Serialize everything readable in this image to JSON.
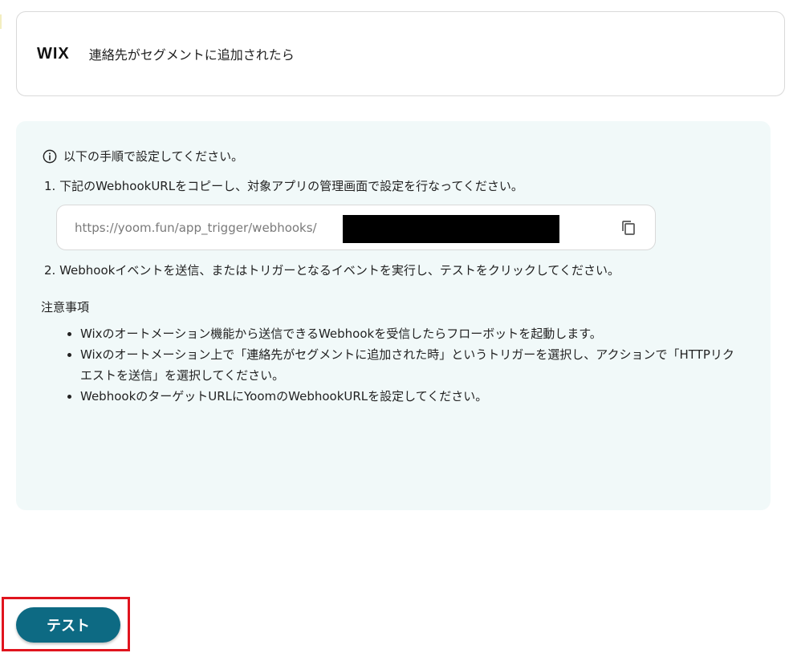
{
  "trigger": {
    "app_logo": "WIX",
    "title": "連絡先がセグメントに追加されたら"
  },
  "instructions": {
    "header": "以下の手順で設定してください。",
    "step1": "1. 下記のWebhookURLをコピーし、対象アプリの管理画面で設定を行なってください。",
    "webhook_url": "https://yoom.fun/app_trigger/webhooks/",
    "step2": "2. Webhookイベントを送信、またはトリガーとなるイベントを実行し、テストをクリックしてください。"
  },
  "notes": {
    "title": "注意事項",
    "items": [
      "Wixのオートメーション機能から送信できるWebhookを受信したらフローボットを起動します。",
      "Wixのオートメーション上で「連絡先がセグメントに追加された時」というトリガーを選択し、アクションで「HTTPリクエストを送信」を選択してください。",
      "WebhookのターゲットURLにYoomのWebhookURLを設定してください。"
    ]
  },
  "actions": {
    "test_label": "テスト"
  },
  "icons": {
    "info": "info-icon",
    "copy": "copy-icon"
  },
  "colors": {
    "panel_bg": "#f1f9f9",
    "button_bg": "#0d6a83",
    "highlight_border": "#e0141e"
  }
}
